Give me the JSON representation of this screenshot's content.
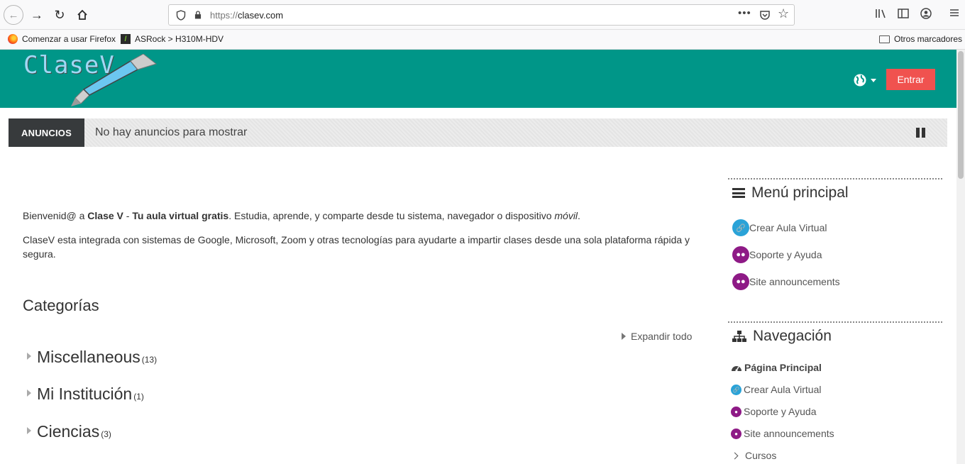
{
  "browser": {
    "url_proto": "https://",
    "url_host": "clasev.com",
    "bookmarks": [
      {
        "label": "Comenzar a usar Firefox"
      },
      {
        "label": "ASRock > H310M-HDV"
      }
    ],
    "other_bookmarks": "Otros marcadores"
  },
  "header": {
    "logo": "ClaseV",
    "login_label": "Entrar",
    "brand_color": "#009688",
    "login_color": "#f0524f"
  },
  "announcements": {
    "label": "ANUNCIOS",
    "text": "No hay anuncios para mostrar"
  },
  "intro": {
    "p1_a": "Bienvenid@ a ",
    "p1_b": "Clase V",
    "p1_c": " - ",
    "p1_d": "Tu aula virtual gratis",
    "p1_e": ". Estudia, aprende, y comparte desde tu sistema, navegador o dispositivo ",
    "p1_f": "móvil",
    "p1_g": ".",
    "p2": "ClaseV esta integrada con sistemas de Google, Microsoft, Zoom y otras tecnologías para ayudarte a impartir clases desde una sola plataforma rápida y segura."
  },
  "categories": {
    "title": "Categorías",
    "expand_all": "Expandir todo",
    "items": [
      {
        "name": "Miscellaneous",
        "count": "(13)"
      },
      {
        "name": "Mi Institución",
        "count": "(1)"
      },
      {
        "name": "Ciencias",
        "count": "(3)"
      }
    ]
  },
  "main_menu": {
    "title": "Menú principal",
    "items": [
      {
        "label": "Crear Aula Virtual",
        "icon": "link-icon"
      },
      {
        "label": "Soporte y Ayuda",
        "icon": "users-icon"
      },
      {
        "label": "Site announcements",
        "icon": "users-icon"
      }
    ]
  },
  "navigation": {
    "title": "Navegación",
    "home": "Página Principal",
    "items": [
      {
        "label": "Crear Aula Virtual"
      },
      {
        "label": "Soporte y Ayuda"
      },
      {
        "label": "Site announcements"
      }
    ],
    "courses": "Cursos"
  }
}
